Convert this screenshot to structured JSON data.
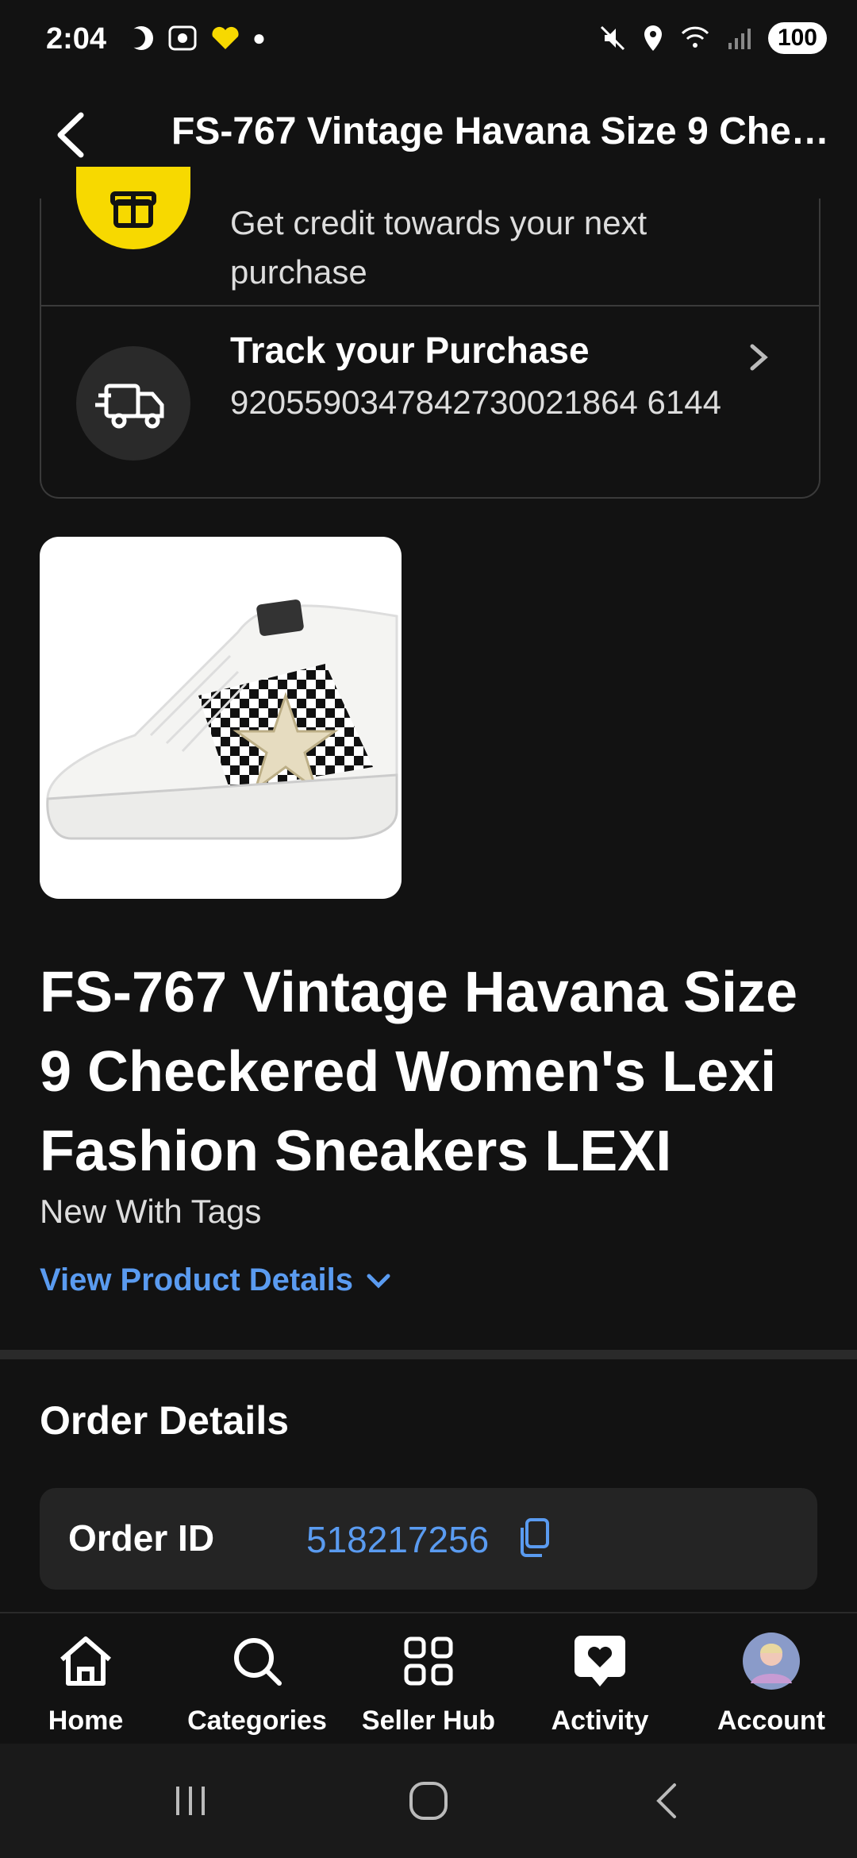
{
  "status_bar": {
    "time": "2:04",
    "battery": "100"
  },
  "header": {
    "back_icon": "back-arrow-icon",
    "title": "FS-767 Vintage Havana Size 9 Checkered Women's Lexi Fashion Sneakers LEXI"
  },
  "rewards_card": {
    "credit_text": "Get credit towards your next purchase",
    "gift_icon": "gift-icon",
    "accent_color": "#f7d900"
  },
  "tracking": {
    "title": "Track your Purchase",
    "number": "9205590347842730021864 6144",
    "icon": "delivery-truck-icon"
  },
  "product": {
    "title": "FS-767 Vintage Havana Size 9 Checkered Women's Lexi Fashion Sneakers LEXI",
    "condition": "New With Tags",
    "view_details": "View Product Details"
  },
  "order_details": {
    "heading": "Order Details",
    "order_id_label": "Order ID",
    "order_id": "518217256",
    "link_color": "#5a9bf0"
  },
  "bottom_nav": [
    {
      "label": "Home",
      "icon": "home-icon"
    },
    {
      "label": "Categories",
      "icon": "search-icon"
    },
    {
      "label": "Seller Hub",
      "icon": "grid-icon"
    },
    {
      "label": "Activity",
      "icon": "heart-chat-icon"
    },
    {
      "label": "Account",
      "icon": "avatar"
    }
  ]
}
